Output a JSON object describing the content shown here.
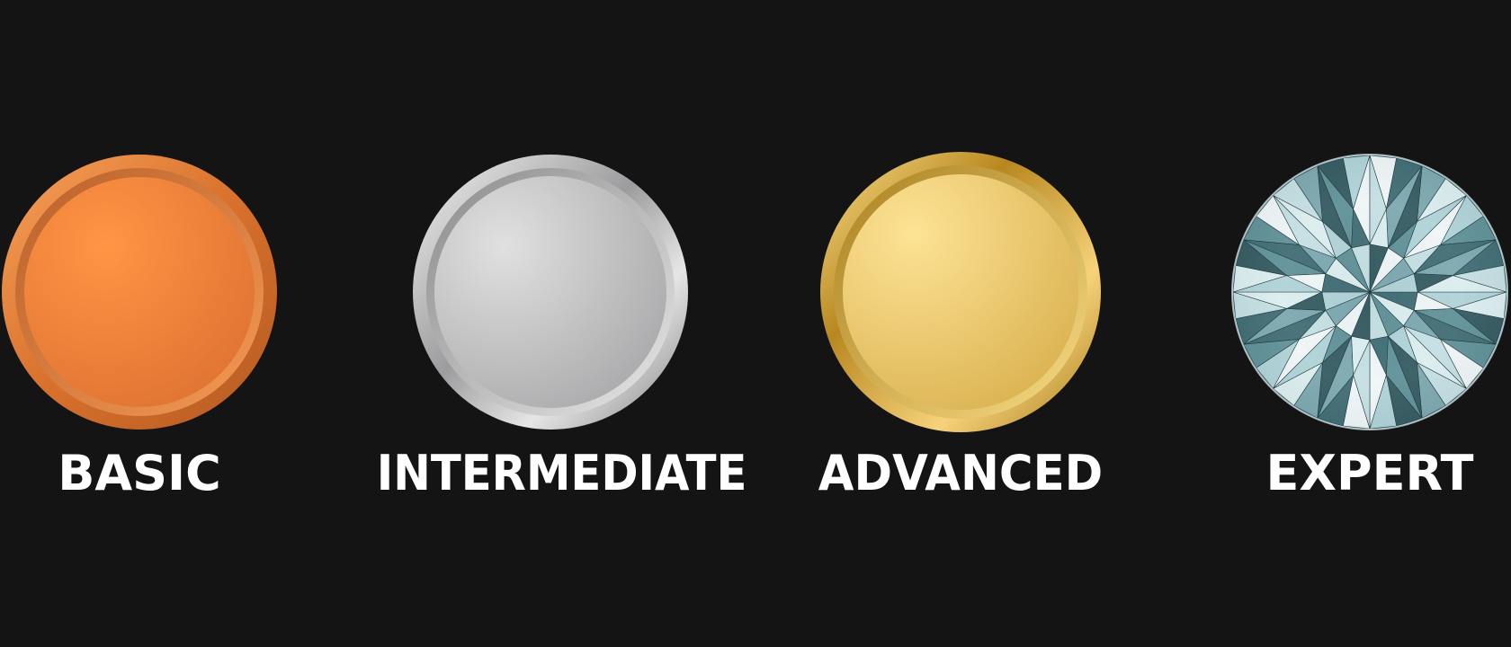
{
  "levels": [
    {
      "label": "BASIC",
      "icon": "bronze-medal-icon",
      "color": "#F08A3E"
    },
    {
      "label": "INTERMEDIATE",
      "icon": "silver-medal-icon",
      "color": "#C4C4C6"
    },
    {
      "label": "ADVANCED",
      "icon": "gold-medal-icon",
      "color": "#E9C765"
    },
    {
      "label": "EXPERT",
      "icon": "diamond-icon",
      "color": "#8FB7BE"
    }
  ],
  "background": "#141414"
}
